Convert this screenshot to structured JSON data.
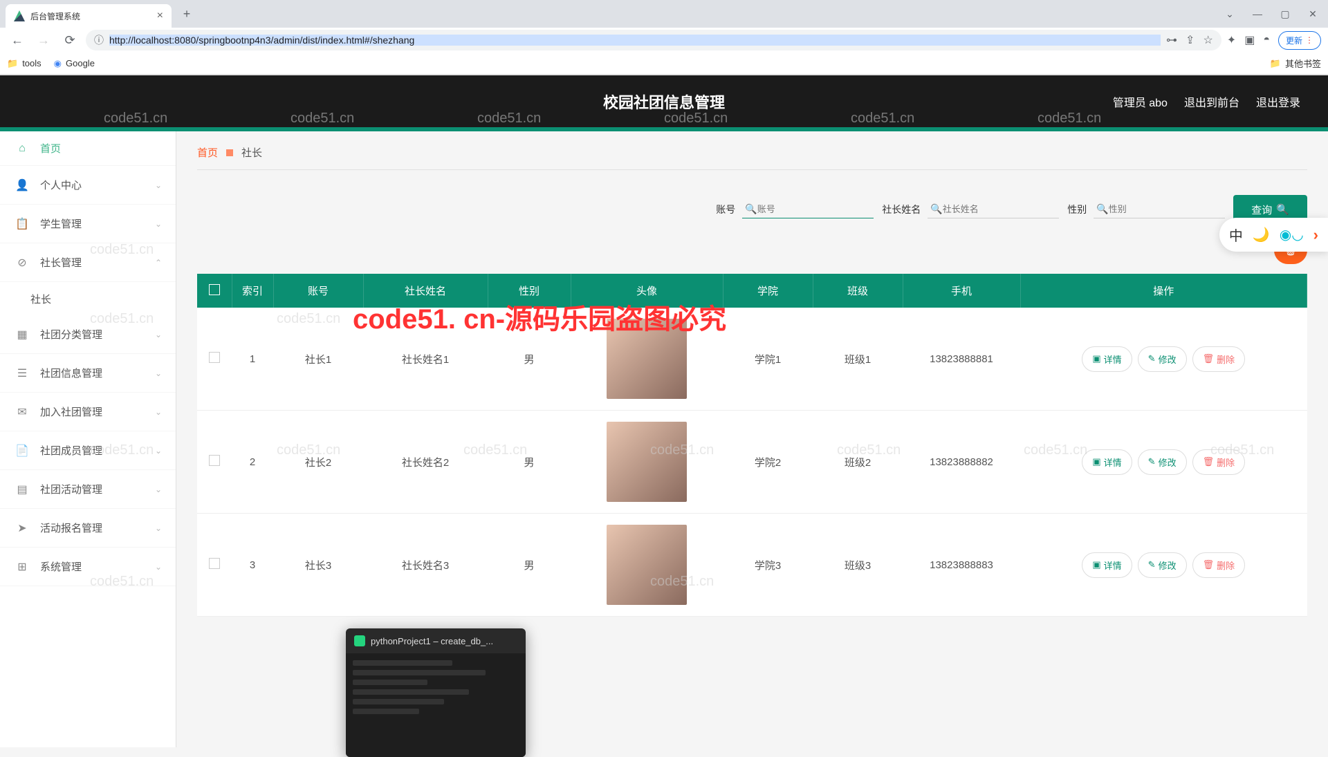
{
  "browser": {
    "tab_title": "后台管理系统",
    "url": "http://localhost:8080/springbootnp4n3/admin/dist/index.html#/shezhang",
    "update_label": "更新",
    "bookmarks": {
      "tools": "tools",
      "google": "Google",
      "other": "其他书签"
    }
  },
  "header": {
    "app_title": "校园社团信息管理",
    "admin_label": "管理员 abo",
    "logout_front": "退出到前台",
    "logout": "退出登录"
  },
  "sidebar": {
    "home": "首页",
    "items": [
      {
        "label": "个人中心",
        "icon": "👤"
      },
      {
        "label": "学生管理",
        "icon": "📋"
      },
      {
        "label": "社长管理",
        "icon": "⊘",
        "expanded": true,
        "sub": "社长"
      },
      {
        "label": "社团分类管理",
        "icon": "▦"
      },
      {
        "label": "社团信息管理",
        "icon": "☰"
      },
      {
        "label": "加入社团管理",
        "icon": "✉"
      },
      {
        "label": "社团成员管理",
        "icon": "📄"
      },
      {
        "label": "社团活动管理",
        "icon": "▤"
      },
      {
        "label": "活动报名管理",
        "icon": "➤"
      },
      {
        "label": "系统管理",
        "icon": "⊞"
      }
    ]
  },
  "breadcrumb": {
    "home": "首页",
    "current": "社长"
  },
  "search": {
    "account_label": "账号",
    "account_placeholder": "账号",
    "name_label": "社长姓名",
    "name_placeholder": "社长姓名",
    "gender_label": "性别",
    "gender_placeholder": "性别",
    "button": "查询"
  },
  "table": {
    "headers": [
      "",
      "索引",
      "账号",
      "社长姓名",
      "性别",
      "头像",
      "学院",
      "班级",
      "手机",
      "操作"
    ],
    "rows": [
      {
        "index": "1",
        "account": "社长1",
        "name": "社长姓名1",
        "gender": "男",
        "college": "学院1",
        "class": "班级1",
        "phone": "13823888881"
      },
      {
        "index": "2",
        "account": "社长2",
        "name": "社长姓名2",
        "gender": "男",
        "college": "学院2",
        "class": "班级2",
        "phone": "13823888882"
      },
      {
        "index": "3",
        "account": "社长3",
        "name": "社长姓名3",
        "gender": "男",
        "college": "学院3",
        "class": "班级3",
        "phone": "13823888883"
      }
    ],
    "action_detail": "详情",
    "action_edit": "修改",
    "action_delete": "删除"
  },
  "watermark": {
    "main": "code51. cn-源码乐园盗图必究",
    "faint": "code51.cn"
  },
  "taskbar_preview": {
    "title": "pythonProject1 – create_db_..."
  },
  "floating": {
    "lang": "中"
  }
}
